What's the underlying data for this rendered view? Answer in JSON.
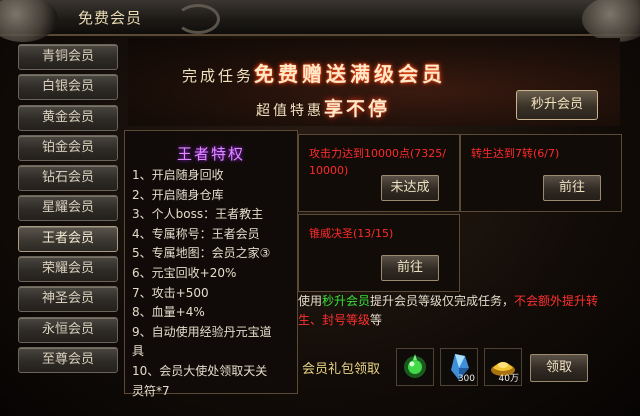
{
  "window": {
    "title": "免费会员"
  },
  "sidebar": {
    "items": [
      {
        "label": "青铜会员"
      },
      {
        "label": "白银会员"
      },
      {
        "label": "黄金会员"
      },
      {
        "label": "铂金会员"
      },
      {
        "label": "钻石会员"
      },
      {
        "label": "星耀会员"
      },
      {
        "label": "王者会员",
        "active": true
      },
      {
        "label": "荣耀会员"
      },
      {
        "label": "神圣会员"
      },
      {
        "label": "永恒会员"
      },
      {
        "label": "至尊会员"
      }
    ]
  },
  "banner": {
    "line1_prefix": "完成任务",
    "line1_emphasis": "免费赠送满级会员",
    "line2_prefix": "超值特惠",
    "line2_emphasis": "享不停",
    "instant_button": "秒升会员"
  },
  "privileges": {
    "title": "王者特权",
    "items": [
      "1、开启随身回收",
      "2、开启随身仓库",
      "3、个人boss：王者教主",
      "4、专属称号：王者会员",
      "5、专属地图：会员之家③",
      "6、元宝回收+20%",
      "7、攻击+500",
      "8、血量+4%",
      "9、自动使用经验丹元宝道",
      "具",
      "10、会员大使处领取天关",
      "灵符*7"
    ]
  },
  "tasks": [
    {
      "text": "攻击力达到10000点(7325/10000)",
      "button": "未达成"
    },
    {
      "text": "转生达到7转(6/7)",
      "button": "前往"
    },
    {
      "text": "锥威决圣(13/15)",
      "button": "前往"
    }
  ],
  "info": {
    "t1": "使用",
    "t2": "秒升会员",
    "t3": "提升会员等级仅完成任务，",
    "t4": "不会额外提升转生、封号等级",
    "t5": "等"
  },
  "rewards": {
    "label": "会员礼包领取",
    "items": [
      {
        "icon": "green-orb-icon",
        "qty": ""
      },
      {
        "icon": "blue-crystal-icon",
        "qty": "300"
      },
      {
        "icon": "gold-ingot-icon",
        "qty": "40万"
      }
    ],
    "claim_button": "领取"
  },
  "colors": {
    "task_text": "#ff2a2a",
    "highlight_green": "#35e03a",
    "privilege_title": "#e08aff",
    "reward_label": "#e8d486"
  }
}
